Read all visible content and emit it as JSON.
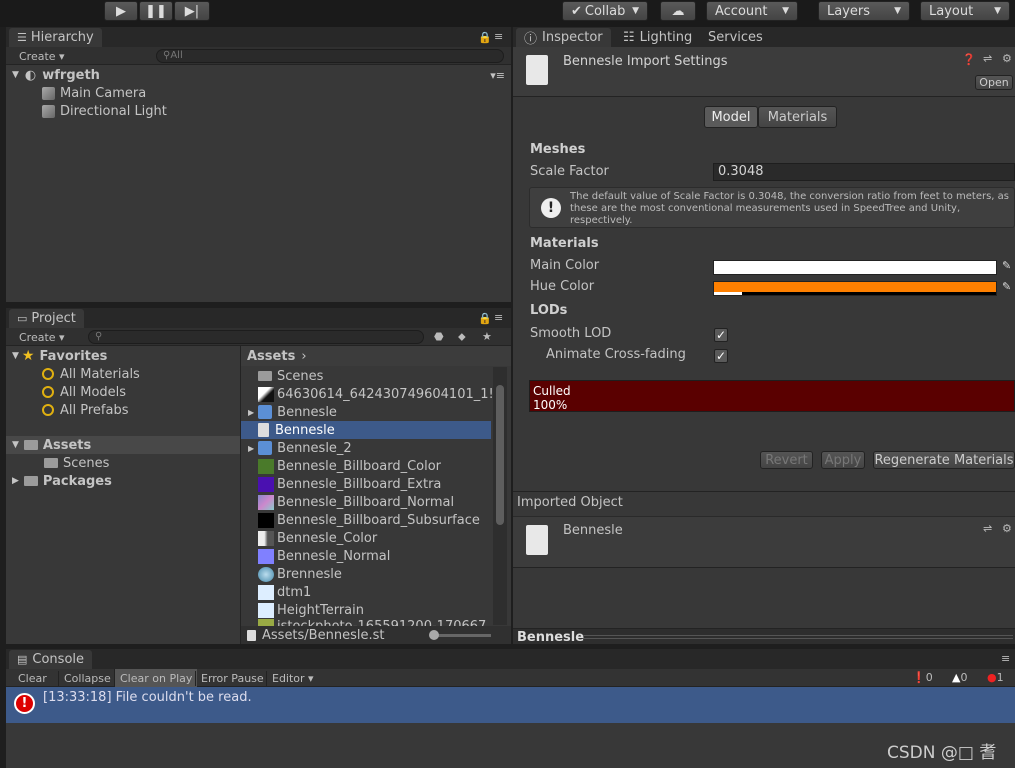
{
  "toolbar": {
    "collab": "Collab",
    "account": "Account",
    "layers": "Layers",
    "layout": "Layout"
  },
  "hierarchy": {
    "tab": "Hierarchy",
    "create": "Create",
    "search_placeholder": "All",
    "scene": "wfrgeth",
    "items": [
      "Main Camera",
      "Directional Light"
    ]
  },
  "inspector": {
    "tabs": [
      "Inspector",
      "Lighting",
      "Services"
    ],
    "title": "Bennesle Import Settings",
    "open": "Open",
    "model_tab": "Model",
    "materials_tab": "Materials",
    "meshes_header": "Meshes",
    "scale_label": "Scale Factor",
    "scale_value": "0.3048",
    "info": "The default value of Scale Factor is 0.3048, the conversion ratio from feet to meters, as these are the most conventional measurements used in SpeedTree and Unity, respectively.",
    "materials_header": "Materials",
    "main_color_label": "Main Color",
    "hue_color_label": "Hue Color",
    "main_color": "#ffffff",
    "hue_color": "#ff8000",
    "lods_header": "LODs",
    "smooth_lod": "Smooth LOD",
    "animate_crossfade": "Animate Cross-fading",
    "culled_label": "Culled",
    "culled_pct": "100%",
    "revert": "Revert",
    "apply": "Apply",
    "regen": "Regenerate Materials",
    "imported_header": "Imported Object",
    "imported_name": "Bennesle",
    "preview_title": "Bennesle"
  },
  "project": {
    "tab": "Project",
    "create": "Create",
    "favorites": "Favorites",
    "fav_items": [
      "All Materials",
      "All Models",
      "All Prefabs"
    ],
    "assets": "Assets",
    "scenes": "Scenes",
    "packages": "Packages",
    "breadcrumb": "Assets",
    "files": [
      "Scenes",
      "64630614_642430749604101_1!",
      "Bennesle",
      "Bennesle",
      "Bennesle_2",
      "Bennesle_Billboard_Color",
      "Bennesle_Billboard_Extra",
      "Bennesle_Billboard_Normal",
      "Bennesle_Billboard_Subsurface",
      "Bennesle_Color",
      "Bennesle_Normal",
      "Brennesle",
      "dtm1",
      "HeightTerrain",
      "istockphoto-165591200-170667"
    ],
    "path": "Assets/Bennesle.st"
  },
  "console": {
    "tab": "Console",
    "buttons": [
      "Clear",
      "Collapse",
      "Clear on Play",
      "Error Pause",
      "Editor"
    ],
    "count_info": "0",
    "count_warn": "0",
    "count_err": "1",
    "message": "[13:33:18] File couldn't be read."
  },
  "watermark": "CSDN @□ 耆"
}
